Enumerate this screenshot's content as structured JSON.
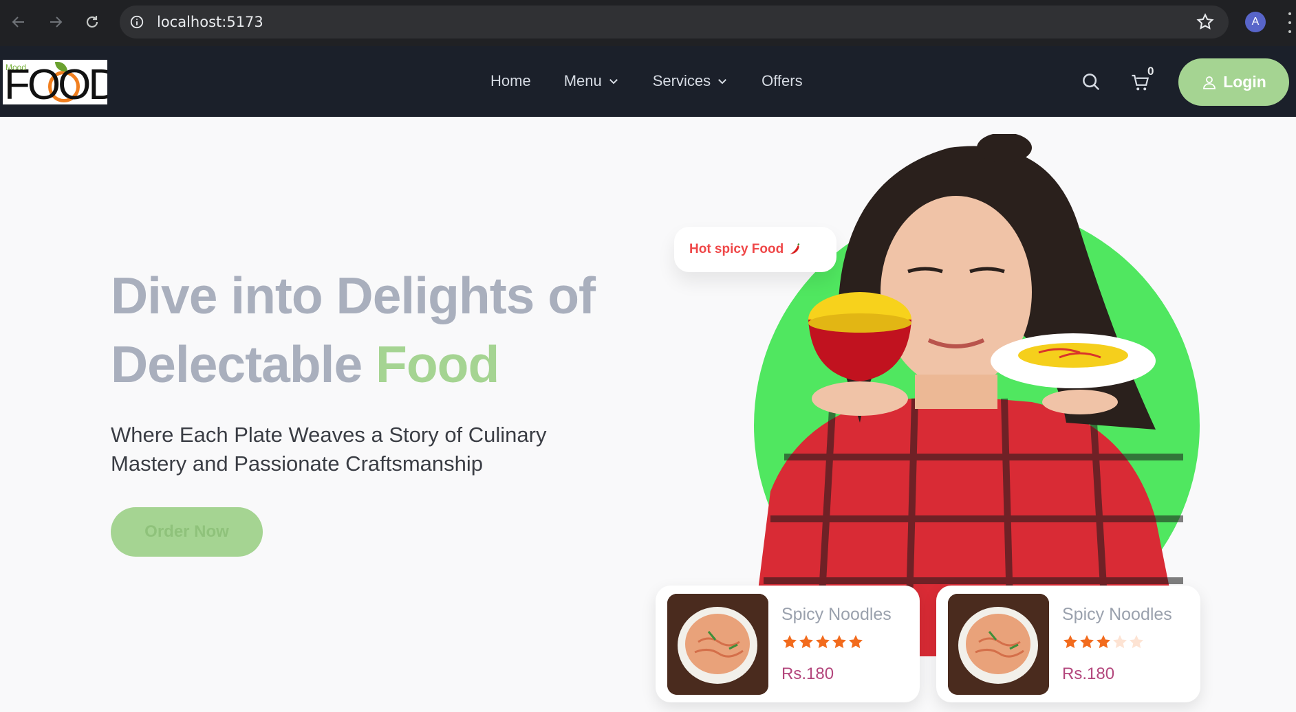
{
  "browser": {
    "url": "localhost:5173",
    "profile_initial": "A",
    "icons": [
      "back-arrow-icon",
      "forward-arrow-icon",
      "reload-icon",
      "info-icon",
      "star-icon",
      "kebab-menu-icon"
    ]
  },
  "header": {
    "logo_small": "Mood",
    "logo_word": "FOOD",
    "nav": [
      {
        "label": "Home",
        "has_dropdown": false
      },
      {
        "label": "Menu",
        "has_dropdown": true
      },
      {
        "label": "Services",
        "has_dropdown": true
      },
      {
        "label": "Offers",
        "has_dropdown": false
      }
    ],
    "cart_count": "0",
    "login_label": "Login"
  },
  "hero": {
    "title_part1": "Dive into Delights of Delectable ",
    "title_accent": "Food",
    "subtitle": "Where Each Plate Weaves a Story of Culinary Mastery and Passionate Craftsmanship",
    "cta_label": "Order Now",
    "badge": "Hot spicy Food"
  },
  "cards": [
    {
      "name": "Spicy Noodles",
      "rating": 5,
      "max_rating": 5,
      "price": "Rs.180"
    },
    {
      "name": "Spicy Noodles",
      "rating": 3,
      "max_rating": 5,
      "price": "Rs.180"
    }
  ],
  "colors": {
    "header_bg": "#1b202a",
    "accent_green": "#a5d492",
    "circle_green": "#50e760",
    "title_gray": "#a9afbd",
    "price": "#b3467c",
    "star": "#f26b1d"
  }
}
